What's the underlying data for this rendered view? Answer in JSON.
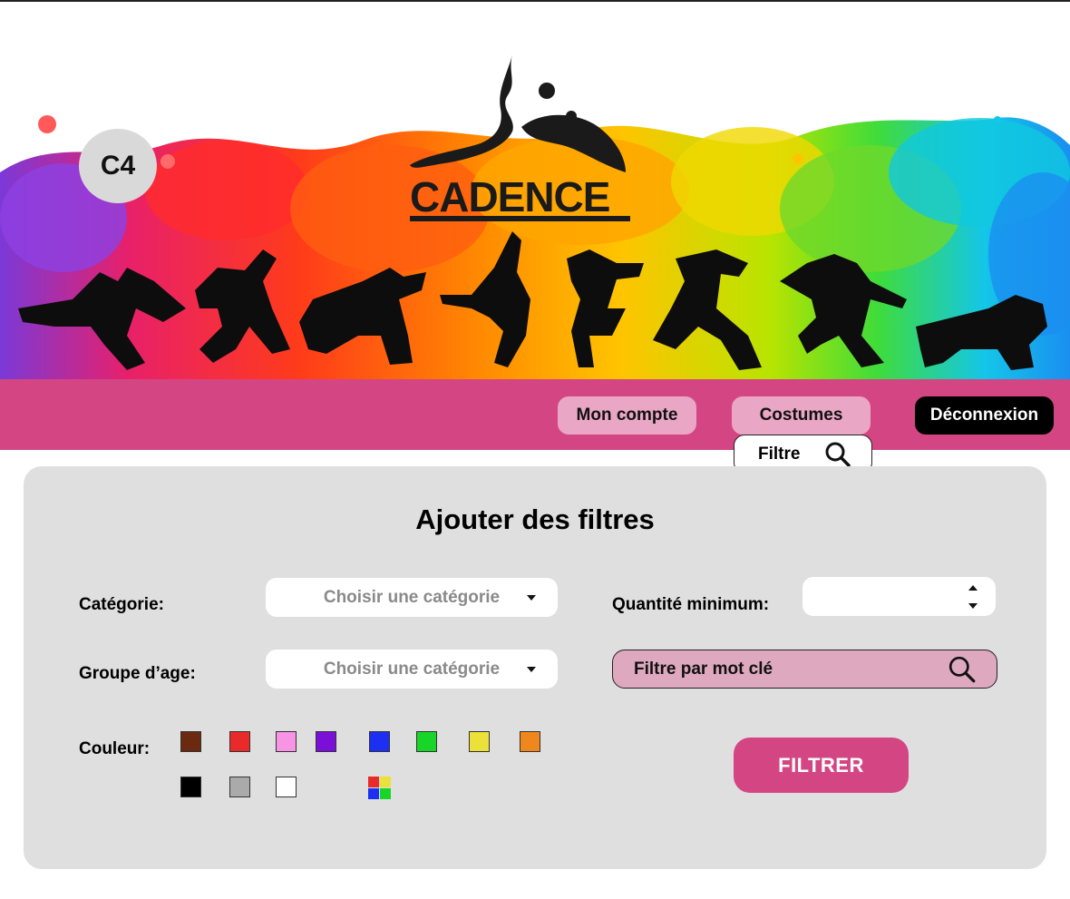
{
  "header": {
    "badge": "C4",
    "logo_text": "CADENCE"
  },
  "nav": {
    "account": "Mon compte",
    "costumes": "Costumes",
    "logout": "Déconnexion",
    "filter_tab": "Filtre"
  },
  "filters": {
    "title": "Ajouter des filtres",
    "category_label": "Catégorie:",
    "category_placeholder": "Choisir une catégorie",
    "age_label": "Groupe d’age:",
    "age_placeholder": "Choisir une catégorie",
    "quantity_label": "Quantité minimum:",
    "quantity_value": "",
    "keyword_label": "Filtre par mot clé",
    "color_label": "Couleur:",
    "colors": [
      "#6b2a10",
      "#e82a2a",
      "#f794e3",
      "#7a10d8",
      "#1d2ff0",
      "#17d628",
      "#ece03a",
      "#f0861e",
      "#000000",
      "#aaaaaa",
      "#ffffff"
    ],
    "multicolor": [
      "#e82a2a",
      "#ece03a",
      "#1d2ff0",
      "#17d628"
    ],
    "submit": "FILTRER"
  }
}
